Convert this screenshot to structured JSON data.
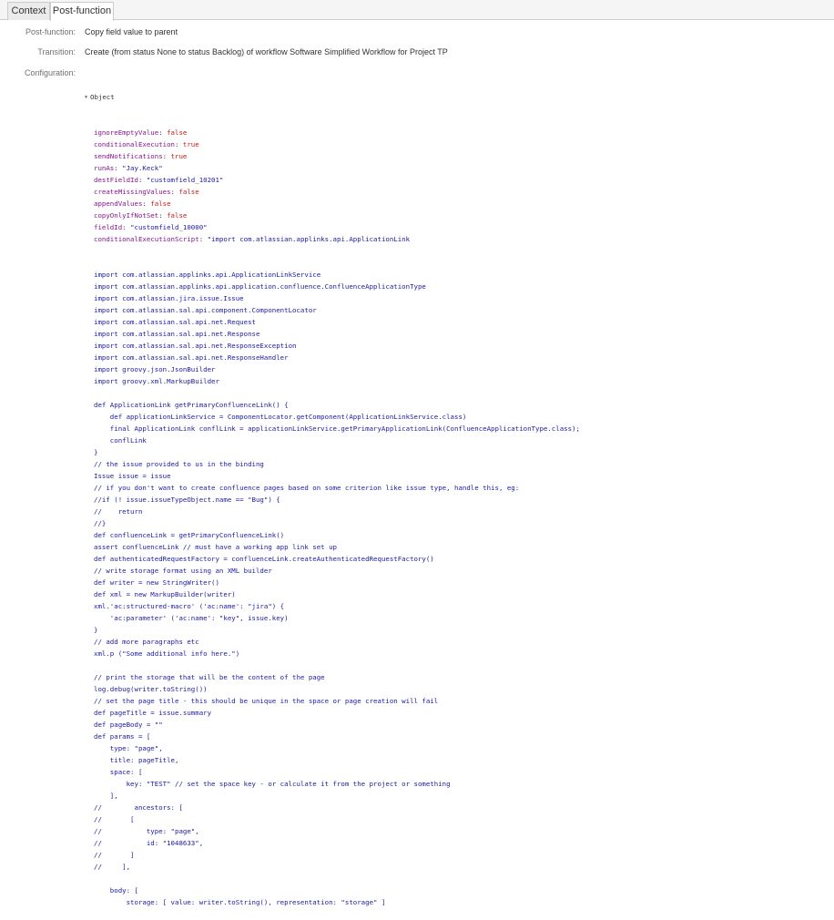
{
  "tabs": [
    {
      "label": "Context"
    },
    {
      "label": "Post-function"
    }
  ],
  "fields": {
    "postfunction": {
      "label": "Post-function:",
      "value": "Copy field value to parent"
    },
    "transition": {
      "label": "Transition:",
      "value": "Create (from status None to status Backlog) of workflow Software Simplified Workflow for Project TP"
    },
    "configuration": {
      "label": "Configuration:"
    }
  },
  "config": {
    "root_label": "Object",
    "props": [
      {
        "key": "ignoreEmptyValue",
        "value": "false",
        "kind": "bool"
      },
      {
        "key": "conditionalExecution",
        "value": "true",
        "kind": "bool"
      },
      {
        "key": "sendNotifications",
        "value": "true",
        "kind": "bool"
      },
      {
        "key": "runAs",
        "value": "\"Jay.Keck\"",
        "kind": "str"
      },
      {
        "key": "destFieldId",
        "value": "\"customfield_10201\"",
        "kind": "str"
      },
      {
        "key": "createMissingValues",
        "value": "false",
        "kind": "bool"
      },
      {
        "key": "appendValues",
        "value": "false",
        "kind": "bool"
      },
      {
        "key": "copyOnlyIfNotSet",
        "value": "false",
        "kind": "bool"
      },
      {
        "key": "fieldId",
        "value": "\"customfield_10000\"",
        "kind": "str"
      },
      {
        "key": "conditionalExecutionScript",
        "value": "\"import com.atlassian.applinks.api.ApplicationLink",
        "kind": "str"
      }
    ],
    "script_lines": [
      "import com.atlassian.applinks.api.ApplicationLinkService",
      "import com.atlassian.applinks.api.application.confluence.ConfluenceApplicationType",
      "import com.atlassian.jira.issue.Issue",
      "import com.atlassian.sal.api.component.ComponentLocator",
      "import com.atlassian.sal.api.net.Request",
      "import com.atlassian.sal.api.net.Response",
      "import com.atlassian.sal.api.net.ResponseException",
      "import com.atlassian.sal.api.net.ResponseHandler",
      "import groovy.json.JsonBuilder",
      "import groovy.xml.MarkupBuilder",
      "",
      "def ApplicationLink getPrimaryConfluenceLink() {",
      "    def applicationLinkService = ComponentLocator.getComponent(ApplicationLinkService.class)",
      "    final ApplicationLink conflLink = applicationLinkService.getPrimaryApplicationLink(ConfluenceApplicationType.class);",
      "    conflLink",
      "}",
      "// the issue provided to us in the binding",
      "Issue issue = issue",
      "// if you don't want to create confluence pages based on some criterion like issue type, handle this, eg:",
      "//if (! issue.issueTypeObject.name == \"Bug\") {",
      "//    return",
      "//}",
      "def confluenceLink = getPrimaryConfluenceLink()",
      "assert confluenceLink // must have a working app link set up",
      "def authenticatedRequestFactory = confluenceLink.createAuthenticatedRequestFactory()",
      "// write storage format using an XML builder",
      "def writer = new StringWriter()",
      "def xml = new MarkupBuilder(writer)",
      "xml.'ac:structured-macro' ('ac:name': \"jira\") {",
      "    'ac:parameter' ('ac:name': \"key\", issue.key)",
      "}",
      "// add more paragraphs etc",
      "xml.p (\"Some additional info here.\")",
      "",
      "// print the storage that will be the content of the page",
      "log.debug(writer.toString())",
      "// set the page title - this should be unique in the space or page creation will fail",
      "def pageTitle = issue.summary",
      "def pageBody = \"\"",
      "def params = [",
      "    type: \"page\",",
      "    title: pageTitle,",
      "    space: [",
      "        key: \"TEST\" // set the space key - or calculate it from the project or something",
      "    ],",
      "//        ancestors: [",
      "//       [",
      "//           type: \"page\",",
      "//           id: \"1048633\",",
      "//       ]",
      "//     ],",
      "",
      "    body: [",
      "        storage: [ value: writer.toString(), representation: \"storage\" ]"
    ]
  },
  "colors": {
    "key": "#881391",
    "bool": "#c41a16",
    "string": "#1a1aa6",
    "label": "#707070"
  }
}
